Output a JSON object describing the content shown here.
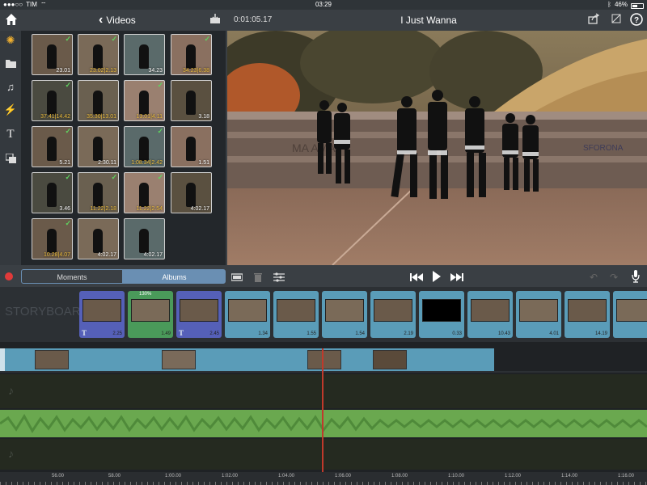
{
  "status": {
    "carrier": "TIM",
    "time": "03:29",
    "battery": "46%",
    "battery_level": 0.46
  },
  "topbar": {
    "back_label": "Videos",
    "timecode": "0:01:05.17",
    "project_title": "I Just Wanna"
  },
  "left_toolbar": {
    "icons": [
      "home-icon",
      "effects-icon",
      "folder-icon",
      "music-icon",
      "transitions-icon",
      "title-icon",
      "pip-icon"
    ]
  },
  "browser": {
    "thumbs": [
      {
        "label": "23.01",
        "checked": true,
        "yellow": false
      },
      {
        "label": "23.02|2.13",
        "checked": true,
        "yellow": true
      },
      {
        "label": "34.23",
        "checked": false,
        "yellow": false
      },
      {
        "label": "34.23|6.38",
        "checked": true,
        "yellow": true
      },
      {
        "label": "37.41|14.42",
        "checked": true,
        "yellow": true
      },
      {
        "label": "35.30|13.01",
        "checked": false,
        "yellow": true
      },
      {
        "label": "13.01|4.11",
        "checked": true,
        "yellow": true
      },
      {
        "label": "3.18",
        "checked": false,
        "yellow": false
      },
      {
        "label": "5.21",
        "checked": true,
        "yellow": false
      },
      {
        "label": "2:30.11",
        "checked": false,
        "yellow": false
      },
      {
        "label": "1:08.34|2.42",
        "checked": true,
        "yellow": true
      },
      {
        "label": "1.51",
        "checked": false,
        "yellow": false
      },
      {
        "label": "3.46",
        "checked": true,
        "yellow": false
      },
      {
        "label": "11.22|2.18",
        "checked": true,
        "yellow": true
      },
      {
        "label": "11.22|2.54",
        "checked": true,
        "yellow": true
      },
      {
        "label": "4:02.17",
        "checked": false,
        "yellow": false
      },
      {
        "label": "10.28|4.07",
        "checked": true,
        "yellow": true
      },
      {
        "label": "4:02.17",
        "checked": false,
        "yellow": false
      },
      {
        "label": "4:02.17",
        "checked": false,
        "yellow": false
      }
    ]
  },
  "segments": {
    "moments": "Moments",
    "albums": "Albums",
    "selected": "albums"
  },
  "storyboard": {
    "watermark": "STORYBOARD",
    "speed_label": "130%",
    "clips": [
      {
        "dur": "2.25",
        "title": true,
        "color": "#5560b8"
      },
      {
        "dur": "1.49",
        "title": false,
        "color": "#4a9a5a"
      },
      {
        "dur": "2.45",
        "title": true,
        "color": "#5560b8"
      },
      {
        "dur": "1.34",
        "title": false,
        "color": "#5a9cb8"
      },
      {
        "dur": "1.55",
        "title": false,
        "color": "#5a9cb8"
      },
      {
        "dur": "1.54",
        "title": false,
        "color": "#5a9cb8"
      },
      {
        "dur": "2.19",
        "title": false,
        "color": "#5a9cb8"
      },
      {
        "dur": "0.33",
        "title": false,
        "color": "#5a9cb8"
      },
      {
        "dur": "10.43",
        "title": false,
        "color": "#5a9cb8"
      },
      {
        "dur": "4.01",
        "title": false,
        "color": "#5a9cb8"
      },
      {
        "dur": "14.19",
        "title": false,
        "color": "#5a9cb8"
      },
      {
        "dur": "",
        "title": false,
        "color": "#5a9cb8"
      }
    ]
  },
  "ruler": {
    "ticks": [
      "56.00",
      "58.00",
      "1:00.00",
      "1:02.00",
      "1:04.00",
      "1:06.00",
      "1:08.00",
      "1:10.00",
      "1:12.00",
      "1:14.00",
      "1:16.00"
    ]
  },
  "colors": {
    "accent": "#6a8fb3",
    "audio": "#6aa84f",
    "playhead": "#c0392b",
    "record": "#e03a3a"
  }
}
